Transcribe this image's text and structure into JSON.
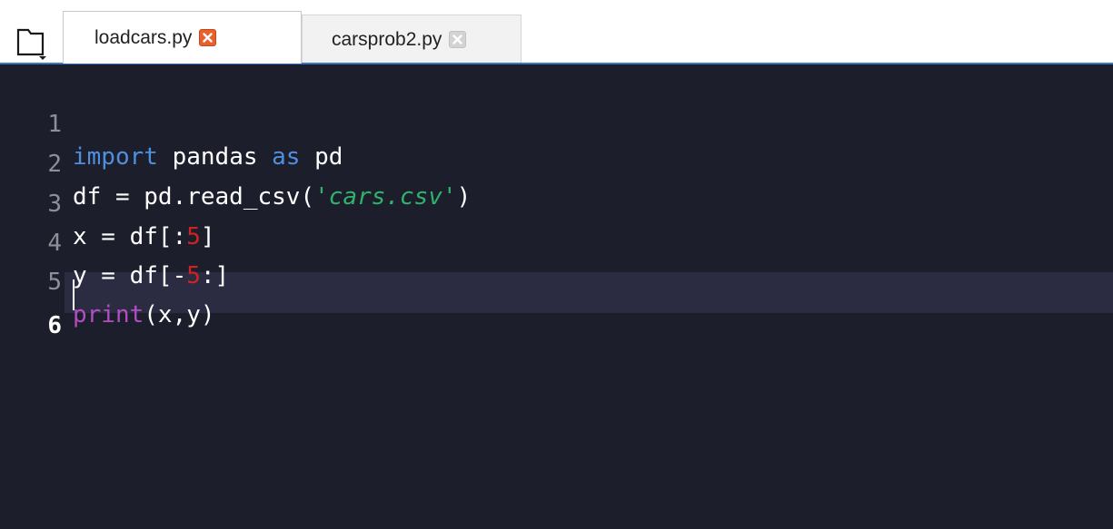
{
  "tabs": [
    {
      "label": "loadcars.py",
      "active": true
    },
    {
      "label": "carsprob2.py",
      "active": false
    }
  ],
  "editor": {
    "current_line": 6,
    "lines": [
      {
        "number": "1",
        "tokens": [
          {
            "text": "import",
            "type": "keyword"
          },
          {
            "text": " pandas ",
            "type": "plain"
          },
          {
            "text": "as",
            "type": "keyword"
          },
          {
            "text": " pd",
            "type": "plain"
          }
        ]
      },
      {
        "number": "2",
        "tokens": [
          {
            "text": "df = pd.read_csv(",
            "type": "plain"
          },
          {
            "text": "'cars.csv'",
            "type": "string"
          },
          {
            "text": ")",
            "type": "plain"
          }
        ]
      },
      {
        "number": "3",
        "tokens": [
          {
            "text": "x = df[:",
            "type": "plain"
          },
          {
            "text": "5",
            "type": "number"
          },
          {
            "text": "]",
            "type": "plain"
          }
        ]
      },
      {
        "number": "4",
        "tokens": [
          {
            "text": "y = df[-",
            "type": "plain"
          },
          {
            "text": "5",
            "type": "number"
          },
          {
            "text": ":]",
            "type": "plain"
          }
        ]
      },
      {
        "number": "5",
        "tokens": [
          {
            "text": "print",
            "type": "builtin"
          },
          {
            "text": "(x,y)",
            "type": "plain"
          }
        ]
      },
      {
        "number": "6",
        "tokens": []
      }
    ]
  },
  "colors": {
    "editor_background": "#1c1e2c",
    "current_line_background": "#2b2c42",
    "keyword": "#4f8fde",
    "builtin": "#b14ec1",
    "string": "#2fb36b",
    "number": "#d02222",
    "tab_underline": "#3b78c4",
    "close_active": "#e8612c"
  },
  "icons": {
    "folder_button": "folder-open-icon",
    "tab_close": "close-icon"
  }
}
